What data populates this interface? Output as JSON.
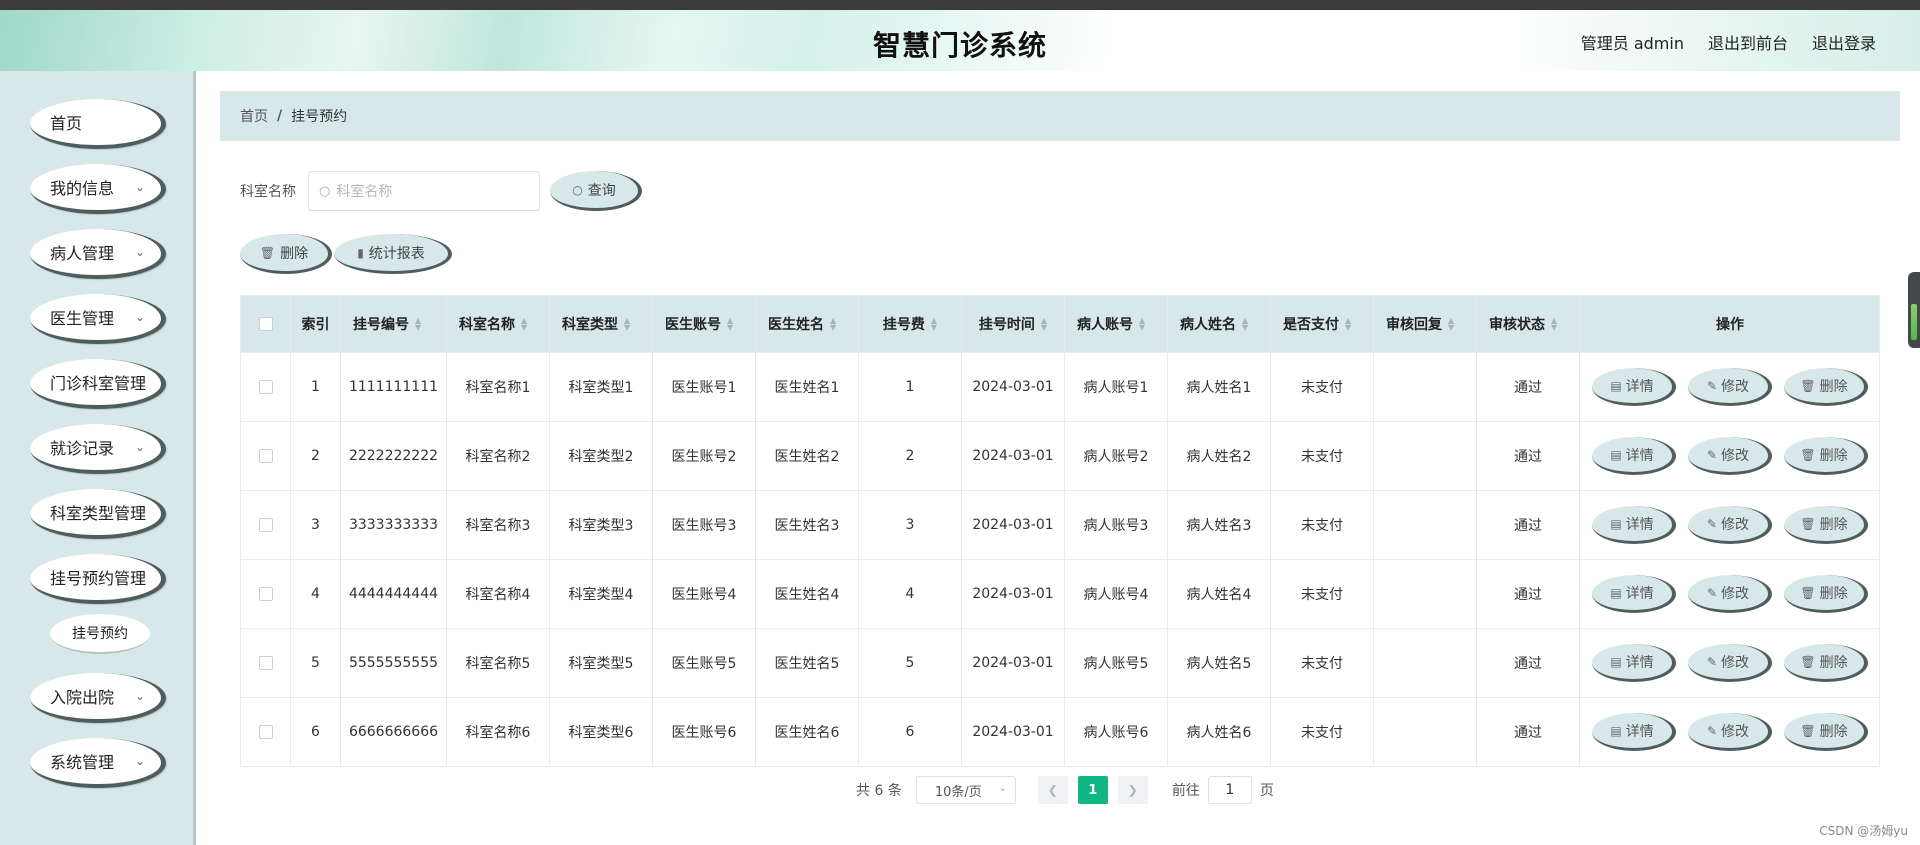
{
  "header": {
    "title": "智慧门诊系统",
    "admin_label": "管理员 admin",
    "exit_front": "退出到前台",
    "logout": "退出登录"
  },
  "sidebar": {
    "items": [
      {
        "label": "首页",
        "has_children": false
      },
      {
        "label": "我的信息",
        "has_children": true
      },
      {
        "label": "病人管理",
        "has_children": true
      },
      {
        "label": "医生管理",
        "has_children": true
      },
      {
        "label": "门诊科室管理",
        "has_children": false
      },
      {
        "label": "就诊记录",
        "has_children": true
      },
      {
        "label": "科室类型管理",
        "has_children": false
      },
      {
        "label": "挂号预约管理",
        "has_children": false
      },
      {
        "label": "入院出院",
        "has_children": true
      },
      {
        "label": "系统管理",
        "has_children": true
      }
    ],
    "sub_item": "挂号预约"
  },
  "breadcrumb": {
    "home": "首页",
    "separator": "/",
    "current": "挂号预约"
  },
  "search": {
    "label": "科室名称",
    "placeholder": "科室名称",
    "query_button": "查询"
  },
  "actions": {
    "delete": "删除",
    "report": "统计报表"
  },
  "table": {
    "columns": [
      "索引",
      "挂号编号",
      "科室名称",
      "科室类型",
      "医生账号",
      "医生姓名",
      "挂号费",
      "挂号时间",
      "病人账号",
      "病人姓名",
      "是否支付",
      "审核回复",
      "审核状态",
      "操作"
    ],
    "rows": [
      {
        "index": "1",
        "reg_no": "1111111111",
        "dept_name": "科室名称1",
        "dept_type": "科室类型1",
        "doc_account": "医生账号1",
        "doc_name": "医生姓名1",
        "fee": "1",
        "time": "2024-03-01",
        "pat_account": "病人账号1",
        "pat_name": "病人姓名1",
        "paid": "未支付",
        "reply": "",
        "status": "通过"
      },
      {
        "index": "2",
        "reg_no": "2222222222",
        "dept_name": "科室名称2",
        "dept_type": "科室类型2",
        "doc_account": "医生账号2",
        "doc_name": "医生姓名2",
        "fee": "2",
        "time": "2024-03-01",
        "pat_account": "病人账号2",
        "pat_name": "病人姓名2",
        "paid": "未支付",
        "reply": "",
        "status": "通过"
      },
      {
        "index": "3",
        "reg_no": "3333333333",
        "dept_name": "科室名称3",
        "dept_type": "科室类型3",
        "doc_account": "医生账号3",
        "doc_name": "医生姓名3",
        "fee": "3",
        "time": "2024-03-01",
        "pat_account": "病人账号3",
        "pat_name": "病人姓名3",
        "paid": "未支付",
        "reply": "",
        "status": "通过"
      },
      {
        "index": "4",
        "reg_no": "4444444444",
        "dept_name": "科室名称4",
        "dept_type": "科室类型4",
        "doc_account": "医生账号4",
        "doc_name": "医生姓名4",
        "fee": "4",
        "time": "2024-03-01",
        "pat_account": "病人账号4",
        "pat_name": "病人姓名4",
        "paid": "未支付",
        "reply": "",
        "status": "通过"
      },
      {
        "index": "5",
        "reg_no": "5555555555",
        "dept_name": "科室名称5",
        "dept_type": "科室类型5",
        "doc_account": "医生账号5",
        "doc_name": "医生姓名5",
        "fee": "5",
        "time": "2024-03-01",
        "pat_account": "病人账号5",
        "pat_name": "病人姓名5",
        "paid": "未支付",
        "reply": "",
        "status": "通过"
      },
      {
        "index": "6",
        "reg_no": "6666666666",
        "dept_name": "科室名称6",
        "dept_type": "科室类型6",
        "doc_account": "医生账号6",
        "doc_name": "医生姓名6",
        "fee": "6",
        "time": "2024-03-01",
        "pat_account": "病人账号6",
        "pat_name": "病人姓名6",
        "paid": "未支付",
        "reply": "",
        "status": "通过"
      }
    ],
    "row_actions": {
      "detail": "详情",
      "edit": "修改",
      "delete": "删除"
    }
  },
  "pagination": {
    "total": "共 6 条",
    "page_size": "10条/页",
    "current_page": "1",
    "goto_label": "前往",
    "goto_value": "1",
    "page_suffix": "页"
  },
  "watermark": "CSDN @汤姆yu",
  "colors": {
    "sidebar_bg": "#d8e8ea",
    "accent": "#10b683",
    "pill_shadow": "#4f5d5f"
  },
  "icons": [
    "search-icon",
    "trash-icon",
    "bar-chart-icon",
    "document-icon",
    "pencil-icon",
    "chevron-down-icon",
    "chevron-left-icon",
    "chevron-right-icon"
  ]
}
